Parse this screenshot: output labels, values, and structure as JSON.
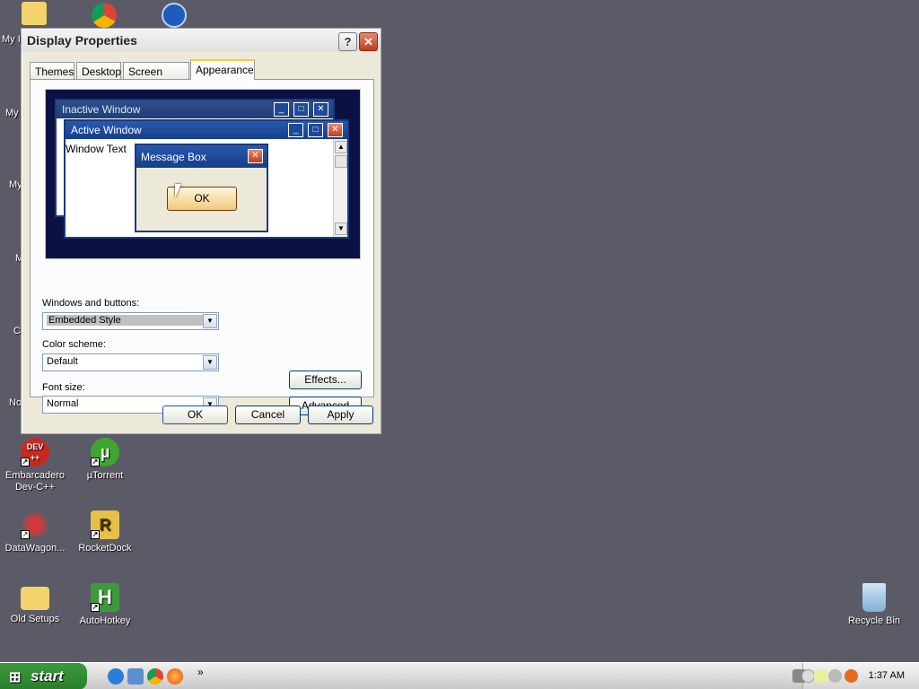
{
  "desktop": {
    "icons": [
      {
        "label": "Embarcadero Dev-C++",
        "line1": "Embarcadero",
        "line2": "Dev-C++",
        "icon": "devcpp-icon"
      },
      {
        "label": "µTorrent",
        "icon": "utorrent-icon"
      },
      {
        "label": "DataWagon...",
        "icon": "datawagon-icon"
      },
      {
        "label": "RocketDock",
        "icon": "rocketdock-icon"
      },
      {
        "label": "Old Setups",
        "icon": "folder-icon"
      },
      {
        "label": "AutoHotkey",
        "icon": "autohotkey-icon"
      },
      {
        "label": "Recycle Bin",
        "icon": "recycle-bin-icon"
      }
    ],
    "edge_labels": [
      "My I",
      "My",
      "My",
      "M",
      "C",
      "No"
    ]
  },
  "dialog": {
    "title": "Display Properties",
    "help_label": "?",
    "close_label": "✕",
    "tabs": [
      "Themes",
      "Desktop",
      "Screen Saver",
      "Appearance"
    ],
    "active_tab": "Appearance",
    "preview": {
      "inactive_title": "Inactive Window",
      "active_title": "Active Window",
      "window_text": "Window Text",
      "msgbox_title": "Message Box",
      "ok_label": "OK"
    },
    "windows_buttons": {
      "label": "Windows and buttons:",
      "value": "Embedded Style"
    },
    "color_scheme": {
      "label": "Color scheme:",
      "value": "Default"
    },
    "font_size": {
      "label": "Font size:",
      "value": "Normal"
    },
    "effects_label": "Effects...",
    "advanced_label": "Advanced",
    "ok_label": "OK",
    "cancel_label": "Cancel",
    "apply_label": "Apply"
  },
  "taskbar": {
    "start_label": "start",
    "chevron": "»",
    "clock": "1:37 AM"
  }
}
